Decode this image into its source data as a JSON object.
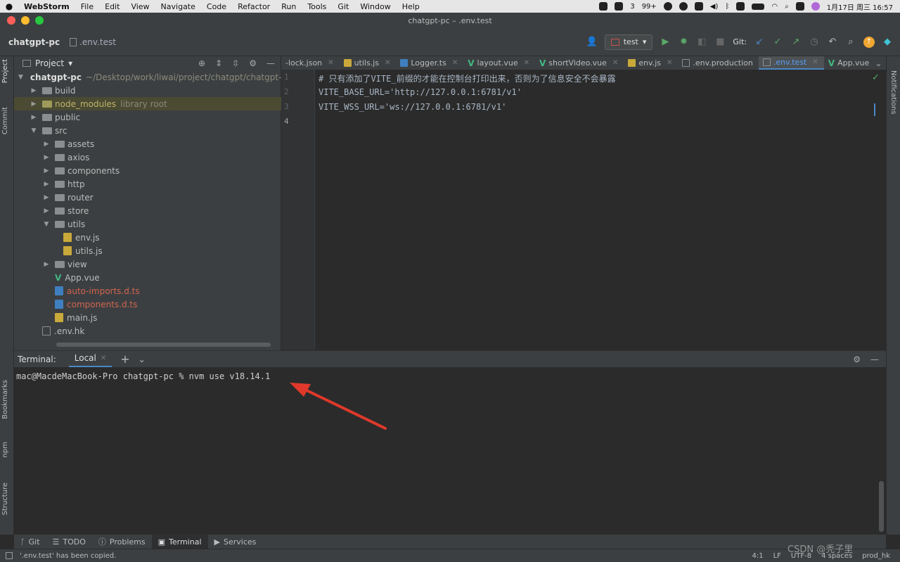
{
  "menubar": {
    "app": "WebStorm",
    "items": [
      "File",
      "Edit",
      "View",
      "Navigate",
      "Code",
      "Refactor",
      "Run",
      "Tools",
      "Git",
      "Window",
      "Help"
    ],
    "badge_count": "3",
    "notif_count": "99+",
    "clock": "1月17日 周三  16:57"
  },
  "window": {
    "title": "chatgpt-pc – .env.test"
  },
  "navbar": {
    "project": "chatgpt-pc",
    "file": ".env.test",
    "run_config": "test",
    "git_label": "Git:"
  },
  "project_panel": {
    "title": "Project",
    "tree": [
      {
        "label": "chatgpt-pc",
        "extra": "~/Desktop/work/liwai/project/chatgpt/chatgpt-",
        "type": "root"
      },
      {
        "label": "build",
        "type": "folder"
      },
      {
        "label": "node_modules",
        "extra": "library root",
        "type": "folder"
      },
      {
        "label": "public",
        "type": "folder"
      },
      {
        "label": "src",
        "type": "folder"
      },
      {
        "label": "assets",
        "type": "folder"
      },
      {
        "label": "axios",
        "type": "folder"
      },
      {
        "label": "components",
        "type": "folder"
      },
      {
        "label": "http",
        "type": "folder"
      },
      {
        "label": "router",
        "type": "folder"
      },
      {
        "label": "store",
        "type": "folder"
      },
      {
        "label": "utils",
        "type": "folder"
      },
      {
        "label": "env.js",
        "type": "js"
      },
      {
        "label": "utils.js",
        "type": "js"
      },
      {
        "label": "view",
        "type": "folder"
      },
      {
        "label": "App.vue",
        "type": "vue"
      },
      {
        "label": "auto-imports.d.ts",
        "type": "ts"
      },
      {
        "label": "components.d.ts",
        "type": "ts"
      },
      {
        "label": "main.js",
        "type": "js"
      },
      {
        "label": ".env.hk",
        "type": "env"
      }
    ]
  },
  "editor": {
    "tabs": [
      {
        "label": "-lock.json",
        "icon": "json"
      },
      {
        "label": "utils.js",
        "icon": "js"
      },
      {
        "label": "Logger.ts",
        "icon": "ts"
      },
      {
        "label": "layout.vue",
        "icon": "vue"
      },
      {
        "label": "shortVideo.vue",
        "icon": "vue"
      },
      {
        "label": "env.js",
        "icon": "js"
      },
      {
        "label": ".env.production",
        "icon": "env"
      },
      {
        "label": ".env.test",
        "icon": "env",
        "active": true
      },
      {
        "label": "App.vue",
        "icon": "vue"
      }
    ],
    "lines": [
      {
        "n": "1",
        "text": "# 只有添加了VITE_前缀的才能在控制台打印出来，否则为了信息安全不会暴露"
      },
      {
        "n": "2",
        "text": "VITE_BASE_URL='http://127.0.0.1:6781/v1'"
      },
      {
        "n": "3",
        "text": "VITE_WSS_URL='ws://127.0.0.1:6781/v1'"
      },
      {
        "n": "4",
        "text": ""
      }
    ]
  },
  "terminal": {
    "title": "Terminal:",
    "tab": "Local",
    "prompt": "mac@MacdeMacBook-Pro chatgpt-pc % nvm use v18.14.1"
  },
  "side_tabs": {
    "left_top": [
      "Project",
      "Commit"
    ],
    "left_bottom": [
      "Bookmarks",
      "npm",
      "Structure"
    ],
    "right": "Notifications"
  },
  "bottom_tools": [
    "Git",
    "TODO",
    "Problems",
    "Terminal",
    "Services"
  ],
  "status": {
    "message": "'.env.test' has been copied.",
    "position": "4:1",
    "line_sep": "LF",
    "encoding": "UTF-8",
    "indent": "4 spaces",
    "branch": "prod_hk"
  },
  "watermark": "CSDN @秃子里"
}
